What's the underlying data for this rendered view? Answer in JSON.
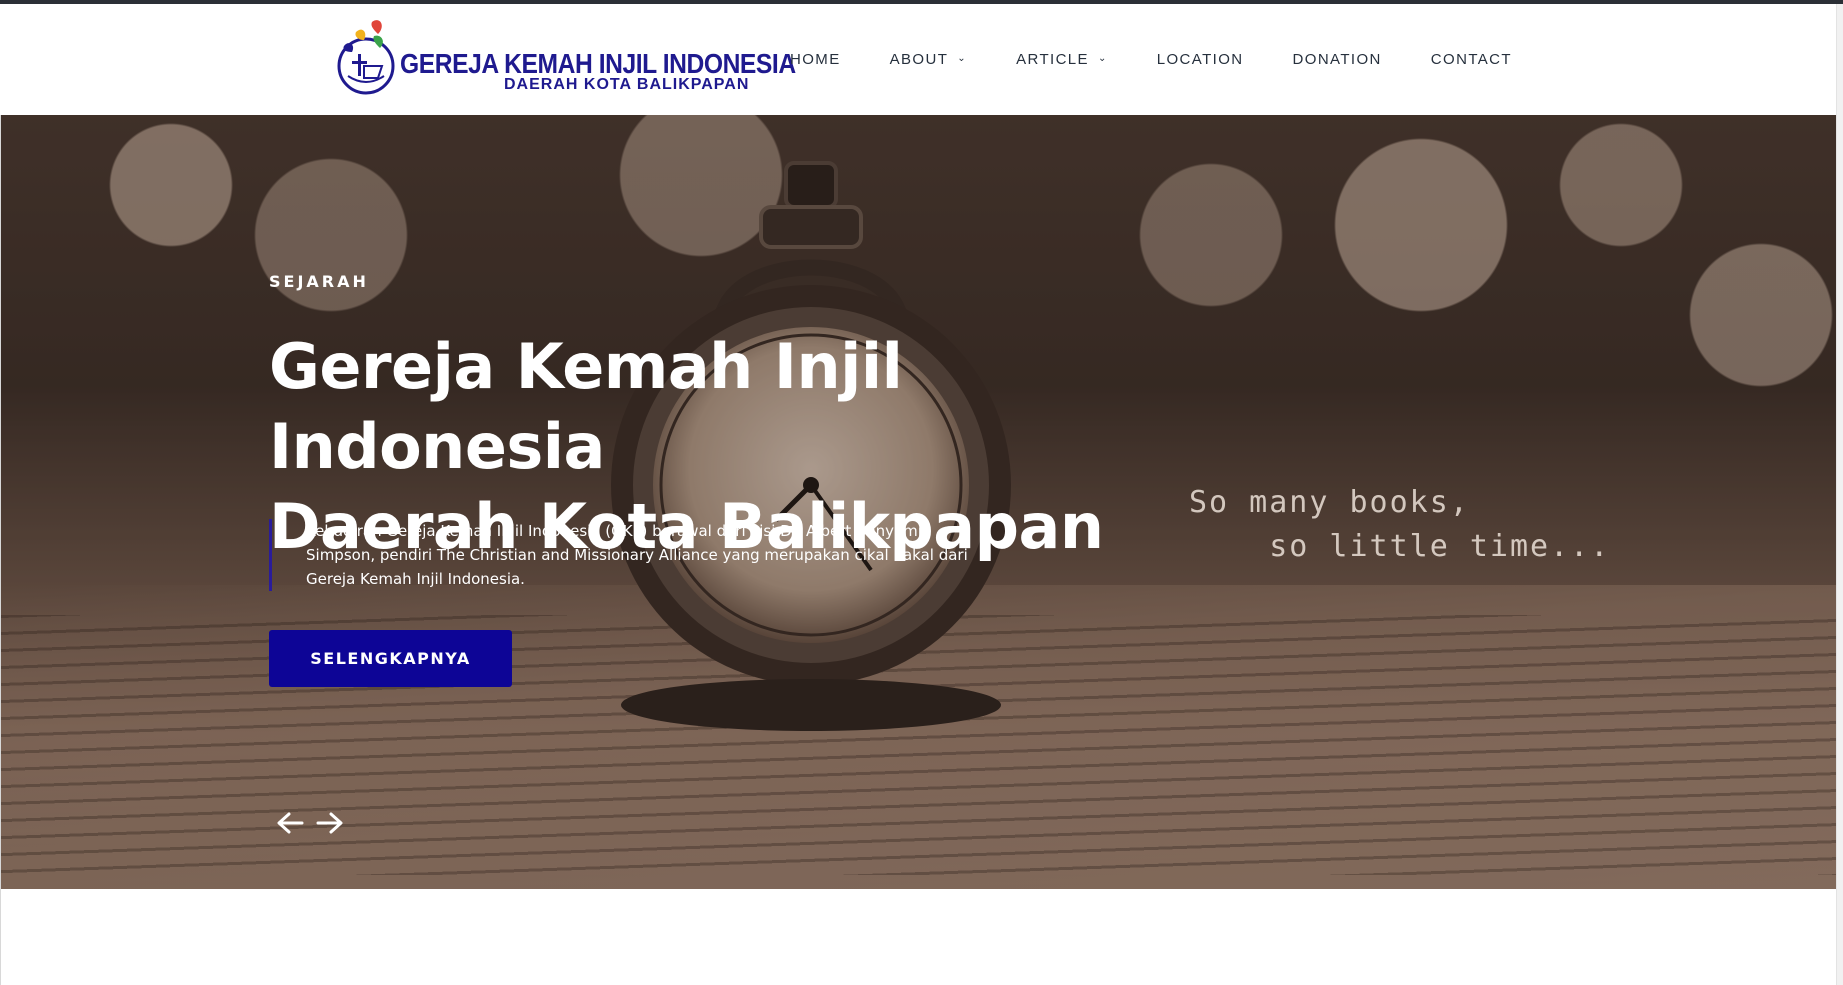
{
  "brand": {
    "title": "GEREJA KEMAH INJIL INDONESIA",
    "subtitle": "DAERAH KOTA BALIKPAPAN",
    "logo_icon": "church-logo-icon",
    "color": "#1f1a8f"
  },
  "nav": {
    "items": [
      {
        "label": "HOME",
        "has_dropdown": false
      },
      {
        "label": "ABOUT",
        "has_dropdown": true
      },
      {
        "label": "ARTICLE",
        "has_dropdown": true
      },
      {
        "label": "LOCATION",
        "has_dropdown": false
      },
      {
        "label": "DONATION",
        "has_dropdown": false
      },
      {
        "label": "CONTACT",
        "has_dropdown": false
      }
    ],
    "chevron": "⌄"
  },
  "hero": {
    "eyebrow": "SEJARAH",
    "title_line1": "Gereja Kemah Injil Indonesia",
    "title_line2": "Daerah Kota Balikpapan",
    "description": "Kehadiran Gereja Kemah Injil Indonesia (GKII) berawal dari visi Dr. Albert Benyamin Simpson, pendiri The Christian and Missionary Alliance yang merupakan cikal bakal dari Gereja Kemah Injil Indonesia.",
    "button_label": "SELENGKAPNYA",
    "button_color": "#0d0596",
    "image_quote_line1": "So many books,",
    "image_quote_line2": "    so little time...",
    "prev_icon": "arrow-left-icon",
    "next_icon": "arrow-right-icon"
  }
}
